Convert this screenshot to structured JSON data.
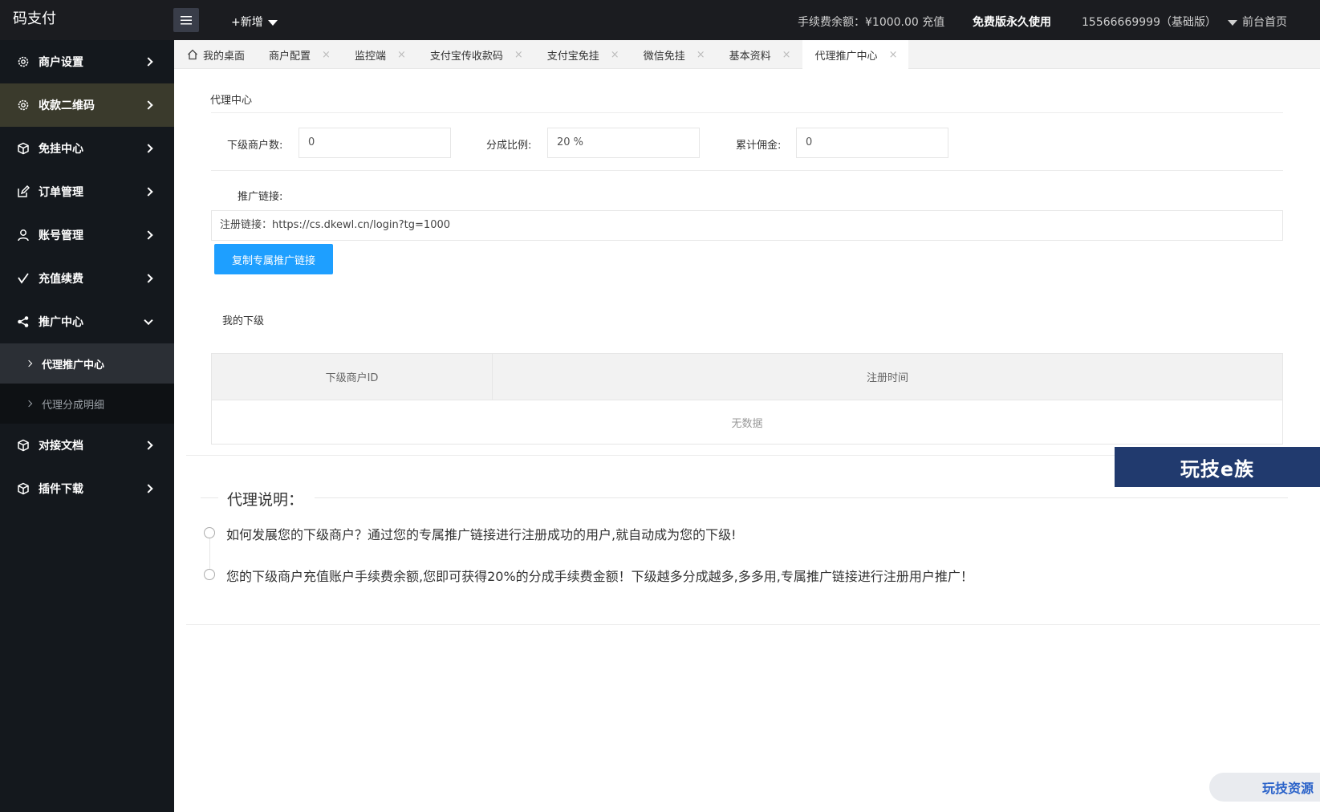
{
  "topbar": {
    "logo": "码支付",
    "add_new": "+新增",
    "balance": "手续费余额：¥1000.00 充值",
    "free_version": "免费版永久使用",
    "account": "15566669999（基础版）",
    "home": "前台首页"
  },
  "sidebar": {
    "items": [
      {
        "label": "商户设置",
        "icon": "gear-icon"
      },
      {
        "label": "收款二维码",
        "icon": "gear-icon"
      },
      {
        "label": "免挂中心",
        "icon": "cube-icon"
      },
      {
        "label": "订单管理",
        "icon": "edit-icon"
      },
      {
        "label": "账号管理",
        "icon": "user-icon"
      },
      {
        "label": "充值续费",
        "icon": "check-icon"
      },
      {
        "label": "推广中心",
        "icon": "share-icon"
      },
      {
        "label": "对接文档",
        "icon": "cube-icon"
      },
      {
        "label": "插件下载",
        "icon": "cube-icon"
      }
    ],
    "sub_items": [
      {
        "label": "代理推广中心"
      },
      {
        "label": "代理分成明细"
      }
    ]
  },
  "tabs": [
    {
      "label": "我的桌面"
    },
    {
      "label": "商户配置"
    },
    {
      "label": "监控端"
    },
    {
      "label": "支付宝传收款码"
    },
    {
      "label": "支付宝免挂"
    },
    {
      "label": "微信免挂"
    },
    {
      "label": "基本资料"
    },
    {
      "label": "代理推广中心"
    }
  ],
  "tab_close": "×",
  "main": {
    "section_title": "代理中心",
    "fields": {
      "sub_merchants_label": "下级商户数:",
      "sub_merchants_value": "0",
      "ratio_label": "分成比例:",
      "ratio_value": "20 %",
      "commission_label": "累计佣金:",
      "commission_value": "0"
    },
    "link_label": "推广链接:",
    "link_value": "注册链接：https://cs.dkewl.cn/login?tg=1000",
    "copy_button": "复制专属推广链接",
    "subordinates_title": "我的下级",
    "table": {
      "headers": [
        "下级商户ID",
        "注册时间"
      ],
      "empty": "无数据"
    },
    "notes": {
      "title": "代理说明：",
      "items": [
        "如何发展您的下级商户？通过您的专属推广链接进行注册成功的用户,就自动成为您的下级!",
        "您的下级商户充值账户手续费余额,您即可获得20%的分成手续费金额！下级越多分成越多,多多用,专属推广链接进行注册用户推广！"
      ]
    }
  },
  "watermarks": {
    "primary": "玩技e族",
    "secondary": "玩技资源"
  },
  "colors": {
    "topbar": "#1b1c20",
    "sidebar": "#14181d",
    "accent": "#1e9fff",
    "highlight": "#3a3a2c"
  }
}
